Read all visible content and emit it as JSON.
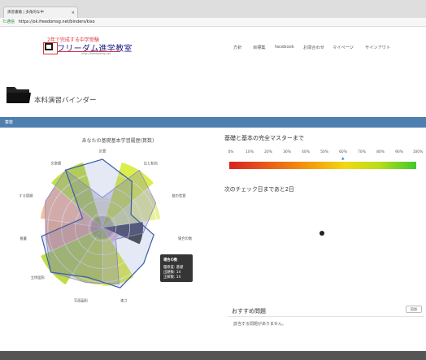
{
  "browser": {
    "tab_title": "演習書籍 | 多角的な中",
    "tab_close": "×",
    "address_secure": "た通信",
    "address_url": "https://ok.freedomsg.net/binders/kiso"
  },
  "site": {
    "tagline": "2年で完成する中学受験",
    "logo_text": "フリーダム進学教室",
    "logo_url": "http://freedomsg.net",
    "nav": [
      "方針",
      "目標集",
      "facebook",
      "お問合わせ",
      "マイページ",
      "サインアウト"
    ]
  },
  "page": {
    "title": "本科演習バインダー",
    "section_label": "算数"
  },
  "radar": {
    "title": "あなたの基礎基本学習履歴(算数)",
    "labels": [
      "計算",
      "比と割合",
      "数の性質",
      "場合の数",
      "規則性",
      "速さ",
      "平面図形",
      "立体図形",
      "推量",
      "条件を整理する問題",
      "文章題"
    ],
    "tooltip": {
      "title": "場合の数",
      "lines": [
        "履修度: 基礎",
        "出題数: 14",
        "正解数: 14"
      ]
    }
  },
  "chart_data": {
    "type": "radar",
    "title": "あなたの基礎基本学習履歴(算数)",
    "categories": [
      "計算",
      "比と割合",
      "数の性質",
      "場合の数",
      "規則性",
      "速さ",
      "平面図形",
      "立体図形",
      "推量",
      "条件を整理する問題",
      "文章題"
    ],
    "bands_max": 5,
    "series": [
      {
        "values": [
          2.2,
          5,
          4.3,
          3,
          1.3,
          4.3,
          4.2,
          5,
          4.2,
          4.6,
          5
        ]
      },
      {
        "values": [
          5,
          4,
          2.3,
          3.8,
          4,
          4.6,
          3.8,
          5,
          4.5,
          1.6,
          5
        ]
      }
    ],
    "wedge_colors": [
      "#f7efc9",
      "#d6ec2a",
      "#e4f084",
      "#2e2e2e",
      "#f7c5c5",
      "#d9e73a",
      "#c4da20",
      "#b7d624",
      "#f0a779",
      "#f3b58c",
      "#b8d82c"
    ],
    "grid": true,
    "legend": "none"
  },
  "mastery": {
    "title": "基礎と基本の完全マスターまで",
    "scale": [
      "0%",
      "10%",
      "20%",
      "30%",
      "40%",
      "50%",
      "60%",
      "70%",
      "80%",
      "90%",
      "100%"
    ],
    "marker_value": 60,
    "marker_glyph": "▲"
  },
  "next_check": "次のチェック日まであと2日",
  "recommend": {
    "title": "おすすめ問題",
    "button": "追加",
    "empty": "該当する問題がありません。"
  }
}
